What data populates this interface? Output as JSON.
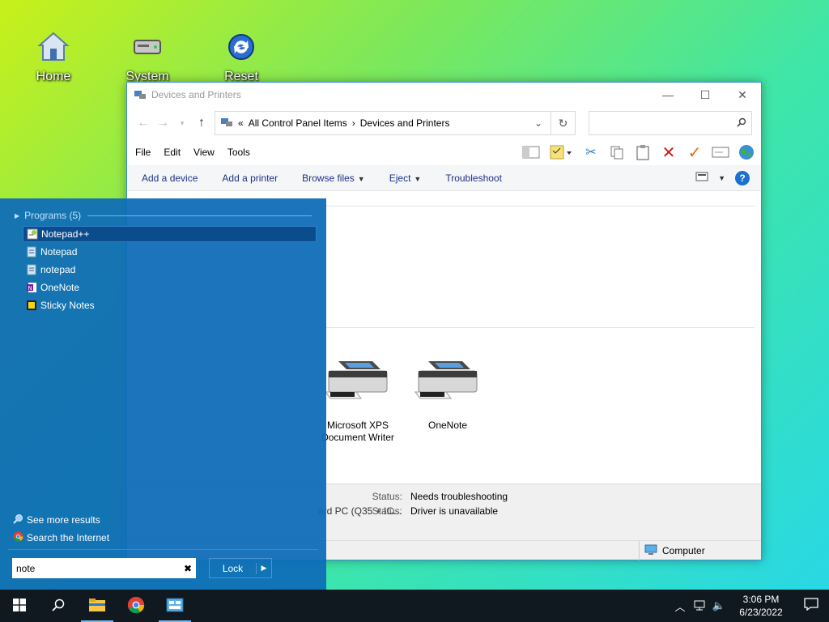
{
  "desktop": {
    "icons": [
      {
        "label": "Home"
      },
      {
        "label": "System"
      },
      {
        "label": "Reset"
      }
    ]
  },
  "window": {
    "title": "Devices and Printers",
    "controls": {
      "minimize": "—",
      "maximize": "☐",
      "close": "✕"
    },
    "address": {
      "prefix": "«",
      "crumbs": [
        "All Control Panel Items",
        "Devices and Printers"
      ],
      "separator": "›"
    },
    "search_placeholder": "",
    "menu": [
      "File",
      "Edit",
      "View",
      "Tools"
    ],
    "commands": [
      {
        "label": "Add a device",
        "dropdown": false
      },
      {
        "label": "Add a printer",
        "dropdown": false
      },
      {
        "label": "Browse files",
        "dropdown": true
      },
      {
        "label": "Eject",
        "dropdown": true
      },
      {
        "label": "Troubleshoot",
        "dropdown": false
      }
    ],
    "devices": [
      {
        "name": "Microsoft XPS Document Writer",
        "line1": "Microsoft XPS",
        "line2": "Document Writer"
      },
      {
        "name": "OneNote",
        "line1": "OneNote",
        "line2": ""
      }
    ],
    "details": {
      "device_partial": "ard PC (Q35 + IC...",
      "status_label": "Status:",
      "status_1": "Needs troubleshooting",
      "status_2": "Driver is unavailable"
    },
    "statusbar": {
      "computer": "Computer"
    }
  },
  "start_panel": {
    "group_header": "Programs (5)",
    "programs": [
      {
        "label": "Notepad++",
        "icon": "notepadpp-icon",
        "selected": true
      },
      {
        "label": "Notepad",
        "icon": "notepad-icon",
        "selected": false
      },
      {
        "label": "notepad",
        "icon": "notepad-icon",
        "selected": false
      },
      {
        "label": "OneNote",
        "icon": "onenote-icon",
        "selected": false
      },
      {
        "label": "Sticky Notes",
        "icon": "sticky-notes-icon",
        "selected": false
      }
    ],
    "see_more": "See more results",
    "search_internet": "Search the Internet",
    "search_value": "note",
    "lock_label": "Lock"
  },
  "taskbar": {
    "time": "3:06 PM",
    "date": "6/23/2022"
  },
  "colors": {
    "start_panel_bg": "#0e6cb8",
    "taskbar_bg": "#101820",
    "window_border": "#3c8fd8",
    "command_text": "#1e3287"
  }
}
